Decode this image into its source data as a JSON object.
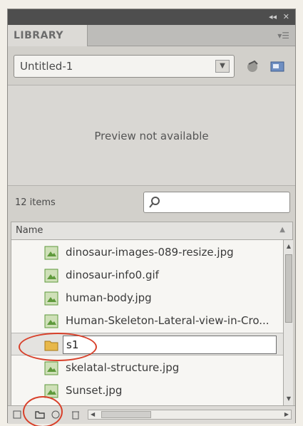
{
  "panel": {
    "tab_label": "LIBRARY"
  },
  "document_select": {
    "value": "Untitled-1"
  },
  "preview": {
    "message": "Preview not available"
  },
  "search": {
    "item_count": "12 items",
    "placeholder": ""
  },
  "list_header": {
    "name_label": "Name"
  },
  "library_items": [
    {
      "name": "dinosaur-images-089-resize.jpg",
      "icon": "bitmap-icon"
    },
    {
      "name": "dinosaur-info0.gif",
      "icon": "bitmap-icon"
    },
    {
      "name": "human-body.jpg",
      "icon": "bitmap-icon"
    },
    {
      "name": "Human-Skeleton-Lateral-view-in-Cro...",
      "icon": "bitmap-icon"
    },
    {
      "name": "s1",
      "icon": "folder-icon",
      "editing": true
    },
    {
      "name": "skelatal-structure.jpg",
      "icon": "bitmap-icon"
    },
    {
      "name": "Sunset.jpg",
      "icon": "bitmap-icon"
    }
  ],
  "colors": {
    "annotation_circle": "#d8402a",
    "folder": "#e8b84a",
    "bitmap": "#5f9a3c"
  }
}
